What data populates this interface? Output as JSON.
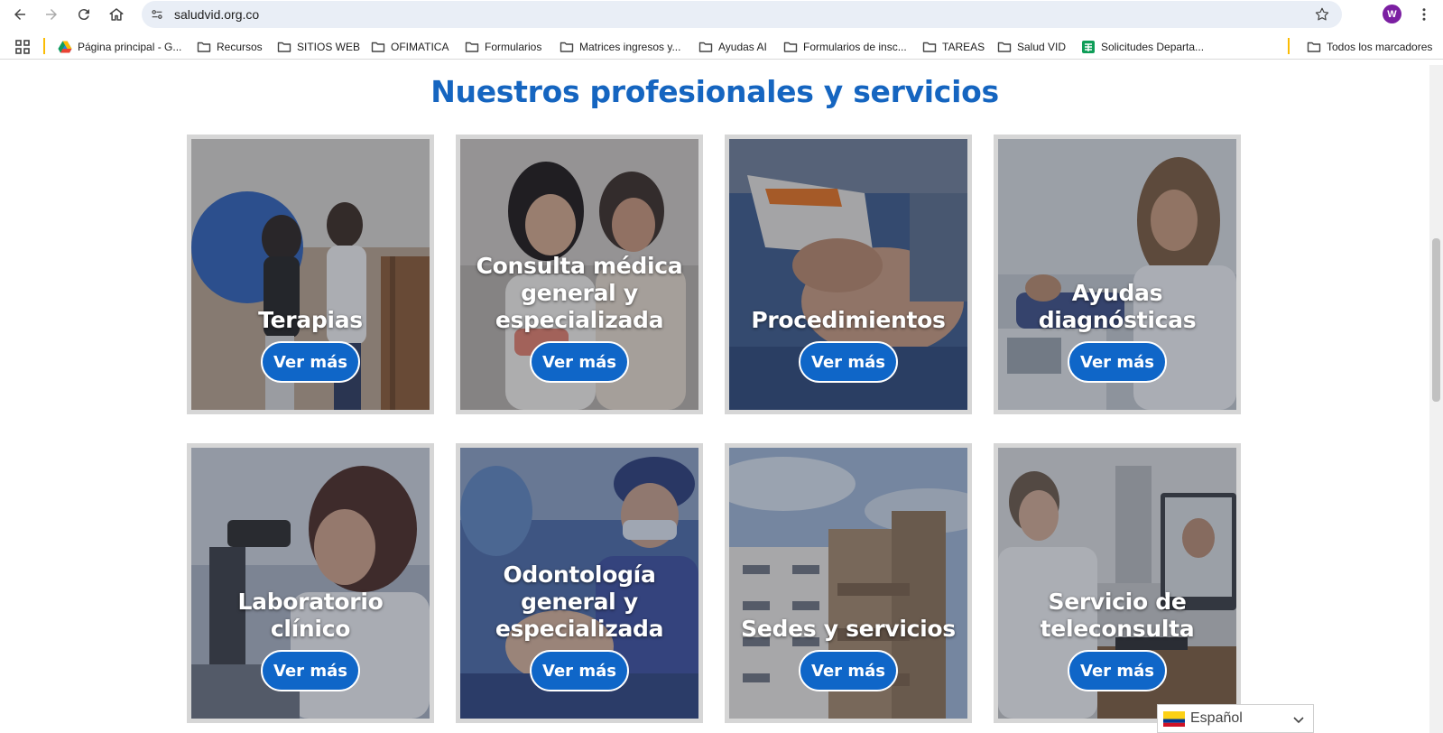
{
  "browser": {
    "url": "saludvid.org.co",
    "profile_initial": "W",
    "bookmarks": [
      {
        "label": "Página principal - G...",
        "icon": "google-drive-icon"
      },
      {
        "label": "Recursos",
        "icon": "folder-icon"
      },
      {
        "label": "SITIOS WEB",
        "icon": "folder-icon"
      },
      {
        "label": "OFIMATICA",
        "icon": "folder-icon"
      },
      {
        "label": "Formularios",
        "icon": "folder-icon"
      },
      {
        "label": "Matrices ingresos y...",
        "icon": "folder-icon"
      },
      {
        "label": "Ayudas AI",
        "icon": "folder-icon"
      },
      {
        "label": "Formularios de insc...",
        "icon": "folder-icon"
      },
      {
        "label": "TAREAS",
        "icon": "folder-icon"
      },
      {
        "label": "Salud VID",
        "icon": "folder-icon"
      },
      {
        "label": "Solicitudes Departa...",
        "icon": "google-sheets-icon"
      }
    ],
    "all_bookmarks_label": "Todos los marcadores"
  },
  "page": {
    "title": "Nuestros profesionales y servicios",
    "cards": [
      {
        "title": "Terapias",
        "button": "Ver más"
      },
      {
        "title": "Consulta médica general y especializada",
        "button": "Ver más"
      },
      {
        "title": "Procedimientos",
        "button": "Ver más"
      },
      {
        "title": "Ayudas diagnósticas",
        "button": "Ver más"
      },
      {
        "title": "Laboratorio clínico",
        "button": "Ver más"
      },
      {
        "title": "Odontología general y especializada",
        "button": "Ver más"
      },
      {
        "title": "Sedes y servicios",
        "button": "Ver más"
      },
      {
        "title": "Servicio de teleconsulta",
        "button": "Ver más"
      }
    ],
    "language_selector": "Español"
  },
  "colors": {
    "title_blue": "#1565c0",
    "button_blue": "#0f66c8",
    "card_frame": "#d6d6d6"
  }
}
